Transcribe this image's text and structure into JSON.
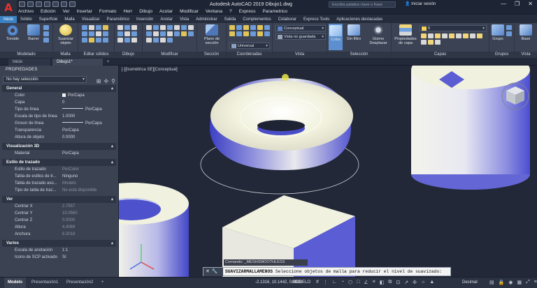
{
  "window": {
    "title": "Autodesk AutoCAD 2019    Dibujo1.dwg",
    "search_placeholder": "Escriba palabra clave o frase",
    "signin": "Iniciar sesión",
    "controls": [
      "—",
      "❐",
      "✕"
    ]
  },
  "menu": [
    "Archivo",
    "Edición",
    "Ver",
    "Insertar",
    "Formato",
    "Herr",
    "Dibujo",
    "Acotar",
    "Modificar",
    "Ventana",
    "?",
    "Express",
    "Parametrico"
  ],
  "ribbon_tabs": [
    {
      "label": "Inicio",
      "active": true
    },
    {
      "label": "Sólido",
      "active": false
    },
    {
      "label": "Superficie",
      "active": false
    },
    {
      "label": "Malla",
      "active": false
    },
    {
      "label": "Visualizar",
      "active": false
    },
    {
      "label": "Paramétrico",
      "active": false
    },
    {
      "label": "Inserción",
      "active": false
    },
    {
      "label": "Anotar",
      "active": false
    },
    {
      "label": "Vista",
      "active": false
    },
    {
      "label": "Administrar",
      "active": false
    },
    {
      "label": "Salida",
      "active": false
    },
    {
      "label": "Complementos",
      "active": false
    },
    {
      "label": "Colaborar",
      "active": false
    },
    {
      "label": "Express Tools",
      "active": false
    },
    {
      "label": "Aplicaciones destacadas",
      "active": false
    }
  ],
  "ribbon": {
    "groups": [
      "Modelado",
      "Malla",
      "Editar sólidos",
      "Dibujo",
      "Modificar",
      "Sección",
      "Coordenadas",
      "Vista",
      "Selección",
      "Capas",
      "Grupos",
      "Vista"
    ],
    "buttons": {
      "toroide": "Toroide",
      "barrer": "Barrer",
      "suavizar": "Suavizar\nobjeto",
      "plano_seccion": "Plano de\nsección",
      "criba": "Criba",
      "sin_filtro": "Sin filtro",
      "gizmo": "Gizmo\nDesplazar",
      "propiedades_capa": "Propiedades\nde capa",
      "grupo": "Grupo",
      "base": "Base"
    },
    "dropdowns": {
      "visual_style": "Conceptual",
      "view": "Vista no guardada",
      "ucs": "Universal",
      "layer": "0"
    }
  },
  "doc_tabs": [
    {
      "label": "Inicio",
      "active": false
    },
    {
      "label": "Dibujo1*",
      "active": true
    }
  ],
  "properties": {
    "title": "PROPIEDADES",
    "selection": "No hay selección",
    "sections": [
      {
        "title": "General",
        "rows": [
          {
            "key": "Color",
            "value": "PorCapa",
            "swatch": true
          },
          {
            "key": "Capa",
            "value": "0"
          },
          {
            "key": "Tipo de línea",
            "value": "PorCapa",
            "line": true
          },
          {
            "key": "Escala de tipo de línea",
            "value": "1.0000"
          },
          {
            "key": "Grosor de línea",
            "value": "PorCapa",
            "line": true
          },
          {
            "key": "Transparencia",
            "value": "PorCapa"
          },
          {
            "key": "Altura de objeto",
            "value": "0.0000"
          }
        ]
      },
      {
        "title": "Visualización 3D",
        "rows": [
          {
            "key": "Material",
            "value": "PorCapa"
          }
        ]
      },
      {
        "title": "Estilo de trazado",
        "rows": [
          {
            "key": "Estilo de trazado",
            "value": "PorColor",
            "dim": true
          },
          {
            "key": "Tabla de estilos de tr...",
            "value": "Ninguno"
          },
          {
            "key": "Tabla de trazado aso...",
            "value": "Modelo",
            "dim": true
          },
          {
            "key": "Tipo de tabla de traz...",
            "value": "No está disponible",
            "dim": true
          }
        ]
      },
      {
        "title": "Ver",
        "rows": [
          {
            "key": "Centrar X",
            "value": "2.7557",
            "dim": true
          },
          {
            "key": "Centrar Y",
            "value": "10.0560",
            "dim": true
          },
          {
            "key": "Centrar Z",
            "value": "0.0000",
            "dim": true
          },
          {
            "key": "Altura",
            "value": "4.4069",
            "dim": true
          },
          {
            "key": "Anchura",
            "value": "8.3018",
            "dim": true
          }
        ]
      },
      {
        "title": "Varios",
        "rows": [
          {
            "key": "Escala de anotación",
            "value": "1:1"
          },
          {
            "key": "Icono de SCP activado",
            "value": "Sí"
          }
        ]
      }
    ]
  },
  "viewport": {
    "label": "[-][Isométrica SE][Conceptual]"
  },
  "command": {
    "history": "Comando: _MESHSMOOTHLESS",
    "prompt_cmd": "SUAVIZARMALLAMENOS",
    "prompt_text": "Seleccione objetos de malla para reducir el nivel de suavizado:"
  },
  "status": {
    "layout_tabs": [
      {
        "label": "Modelo",
        "active": true
      },
      {
        "label": "Presentación1",
        "active": false
      },
      {
        "label": "Presentación2",
        "active": false
      },
      {
        "label": "+",
        "active": false
      }
    ],
    "coords": "-2.1316, 10.1442, 0.0000",
    "model": "MODELO",
    "units": "Decimal"
  },
  "colors": {
    "accent": "#3b82c4",
    "viewport_bg": "#222837",
    "solid_face": "#f0f0dc",
    "solid_side": "#5b5fd6"
  }
}
